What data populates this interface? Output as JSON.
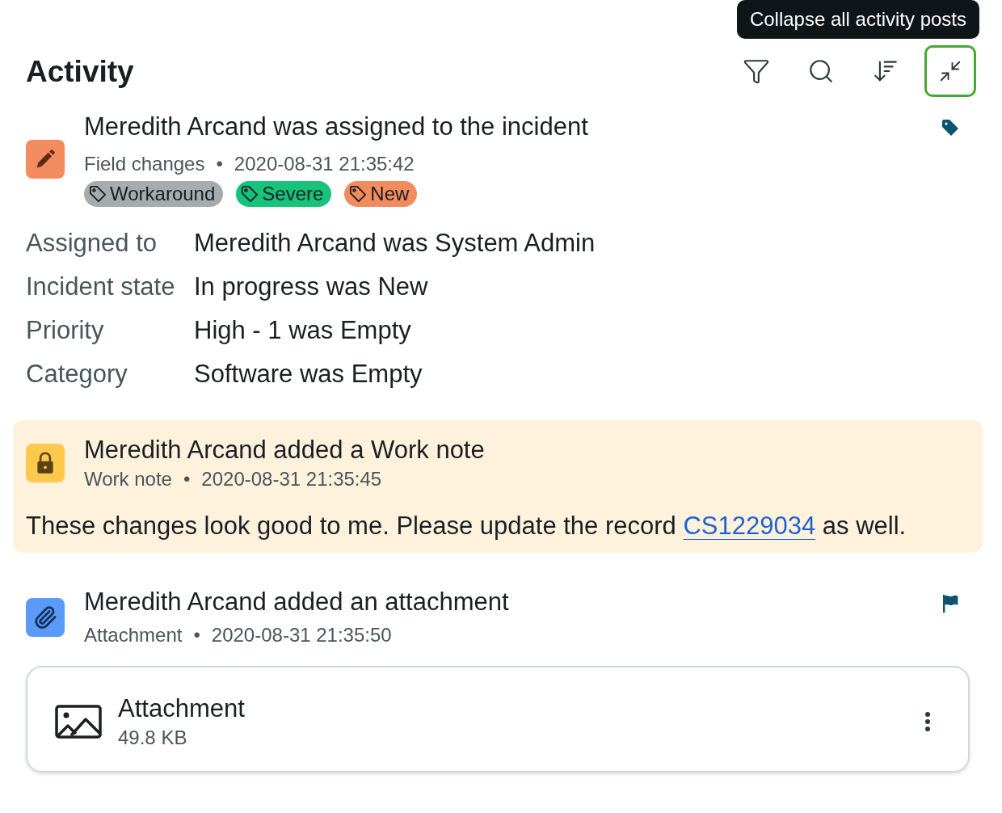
{
  "tooltip": {
    "text": "Collapse all activity posts"
  },
  "header": {
    "title": "Activity",
    "toolbar": [
      {
        "kind": "filter",
        "focused": false
      },
      {
        "kind": "search",
        "focused": false
      },
      {
        "kind": "sort",
        "focused": false
      },
      {
        "kind": "collapse",
        "focused": true
      }
    ]
  },
  "posts": [
    {
      "kind": "field_changes",
      "title": "Meredith Arcand was assigned to the incident",
      "type_label": "Field changes",
      "separator": "•",
      "timestamp": "2020-08-31 21:35:42",
      "marker": {
        "kind": "tag"
      },
      "tags": [
        {
          "label": "Workaround",
          "color": "#a6acae"
        },
        {
          "label": "Severe",
          "color": "#17c27b"
        },
        {
          "label": "New",
          "color": "#f28b5e"
        }
      ],
      "changes": [
        {
          "field": "Assigned to",
          "value": "Meredith Arcand was System Admin"
        },
        {
          "field": "Incident state",
          "value": "In progress was New"
        },
        {
          "field": "Priority",
          "value": "High - 1 was Empty"
        },
        {
          "field": "Category",
          "value": "Software was Empty"
        }
      ]
    },
    {
      "kind": "work_note",
      "title": "Meredith Arcand added a Work note",
      "type_label": "Work note",
      "separator": "•",
      "timestamp": "2020-08-31 21:35:45",
      "body": [
        {
          "kind": "text",
          "text": "These changes look good to me. Please update the record "
        },
        {
          "kind": "link",
          "text": "CS1229034"
        },
        {
          "kind": "text",
          "text": " as well."
        }
      ]
    },
    {
      "kind": "attachment",
      "title": "Meredith Arcand added an attachment",
      "type_label": "Attachment",
      "separator": "•",
      "timestamp": "2020-08-31 21:35:50",
      "marker": {
        "kind": "flag"
      },
      "attachment": {
        "name": "Attachment",
        "size": "49.8 KB"
      }
    }
  ]
}
